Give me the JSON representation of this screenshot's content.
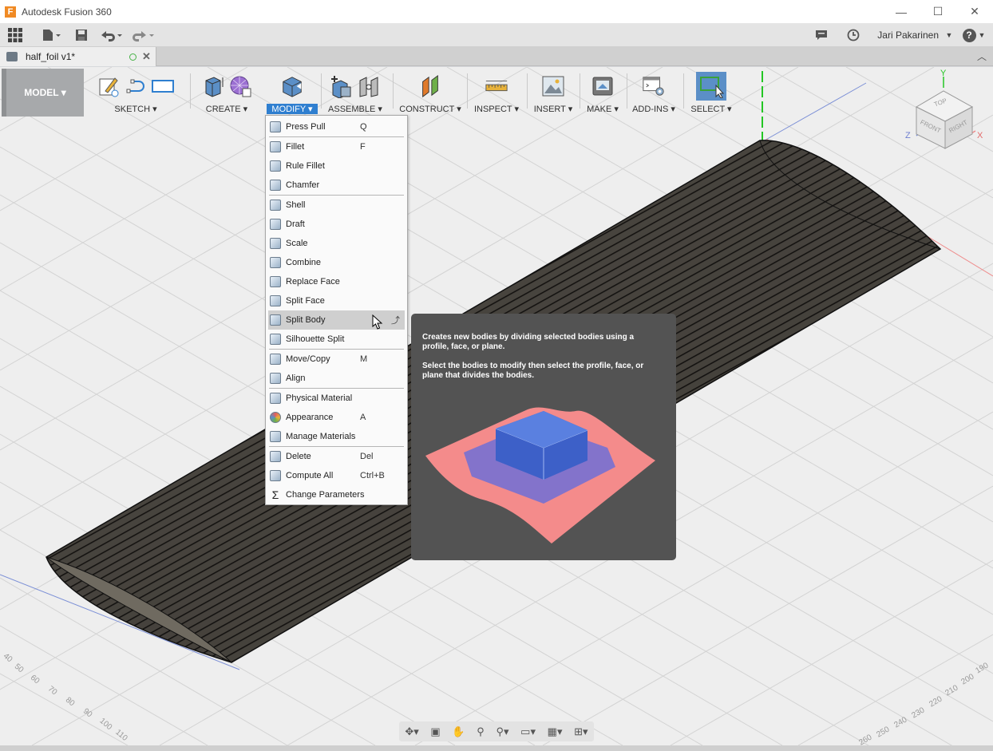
{
  "window": {
    "title": "Autodesk Fusion 360",
    "logo_letter": "F",
    "minimize": "—",
    "maximize": "☐",
    "close": "✕"
  },
  "quick_access": {
    "user_name": "Jari Pakarinen",
    "help": "?"
  },
  "document_tab": {
    "label": "half_foil v1*"
  },
  "toolbar": {
    "workspace": "MODEL ▾",
    "groups": [
      {
        "label": "SKETCH ▾"
      },
      {
        "label": "CREATE ▾"
      },
      {
        "label": "MODIFY ▾"
      },
      {
        "label": "ASSEMBLE ▾"
      },
      {
        "label": "CONSTRUCT ▾"
      },
      {
        "label": "INSPECT ▾"
      },
      {
        "label": "INSERT ▾"
      },
      {
        "label": "MAKE ▾"
      },
      {
        "label": "ADD-INS ▾"
      },
      {
        "label": "SELECT ▾"
      }
    ]
  },
  "modify_menu": {
    "items": [
      {
        "label": "Press Pull",
        "shortcut": "Q"
      },
      {
        "label": "Fillet",
        "shortcut": "F"
      },
      {
        "label": "Rule Fillet",
        "shortcut": ""
      },
      {
        "label": "Chamfer",
        "shortcut": ""
      },
      {
        "label": "Shell",
        "shortcut": ""
      },
      {
        "label": "Draft",
        "shortcut": ""
      },
      {
        "label": "Scale",
        "shortcut": ""
      },
      {
        "label": "Combine",
        "shortcut": ""
      },
      {
        "label": "Replace Face",
        "shortcut": ""
      },
      {
        "label": "Split Face",
        "shortcut": ""
      },
      {
        "label": "Split Body",
        "shortcut": ""
      },
      {
        "label": "Silhouette Split",
        "shortcut": ""
      },
      {
        "label": "Move/Copy",
        "shortcut": "M"
      },
      {
        "label": "Align",
        "shortcut": ""
      },
      {
        "label": "Physical Material",
        "shortcut": ""
      },
      {
        "label": "Appearance",
        "shortcut": "A"
      },
      {
        "label": "Manage Materials",
        "shortcut": ""
      },
      {
        "label": "Delete",
        "shortcut": "Del"
      },
      {
        "label": "Compute All",
        "shortcut": "Ctrl+B"
      },
      {
        "label": "Change Parameters",
        "shortcut": ""
      }
    ],
    "highlighted": "Split Body"
  },
  "tooltip": {
    "line1": "Creates new bodies by dividing selected bodies using a profile, face, or plane.",
    "line2": "Select the bodies to modify then select the profile, face, or plane that divides the bodies."
  },
  "viewcube": {
    "top": "TOP",
    "front": "FRONT",
    "right": "RIGHT",
    "x": "X",
    "y": "Y",
    "z": "Z"
  },
  "grid_ticks": {
    "left": [
      "40",
      "50",
      "60",
      "70",
      "80",
      "90",
      "100",
      "110"
    ],
    "right": [
      "190",
      "200",
      "210",
      "220",
      "230",
      "240",
      "250",
      "260"
    ]
  },
  "colors": {
    "accent": "#2f7fd0",
    "viewport_bg": "#eeeeee",
    "tooltip_bg": "#535353",
    "body": "#3d3a36"
  }
}
